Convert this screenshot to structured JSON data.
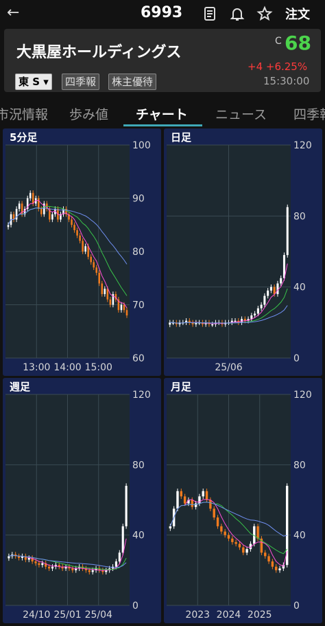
{
  "topbar": {
    "back_icon": "arrow-left-icon",
    "code": "6993",
    "order_label": "注文"
  },
  "header": {
    "name": "大黒屋ホールディングス",
    "close_mark": "C",
    "price": "68",
    "change": "+4 +6.25%",
    "time": "15:30:00",
    "market_badge": "東 S ▾",
    "badges": [
      "四季報",
      "株主優待"
    ]
  },
  "tabs": [
    {
      "label": "市況情報",
      "active": false
    },
    {
      "label": "歩み値",
      "active": false
    },
    {
      "label": "チャート",
      "active": true
    },
    {
      "label": "ニュース",
      "active": false
    },
    {
      "label": "四季報",
      "active": false
    }
  ],
  "colors": {
    "up": "#ffffff",
    "down": "#f07a1e",
    "price_green": "#4cd44c",
    "change_red": "#ff3b3b",
    "panel_bg": "#17234f",
    "plot_bg": "#1d2930",
    "accent": "#3fa9b8"
  },
  "chart_data": [
    {
      "type": "candlestick",
      "title": "5分足",
      "ylim": [
        60,
        100
      ],
      "yticks": [
        "100",
        "90",
        "80",
        "70",
        "60"
      ],
      "xticks": [
        "13:00",
        "14:00",
        "15:00"
      ],
      "series": [
        {
          "values": [
            85,
            87,
            86,
            88,
            89,
            87,
            88,
            90,
            91,
            89,
            90,
            88,
            87,
            89,
            88,
            86,
            87,
            88,
            86,
            87,
            88,
            87,
            86,
            85,
            84,
            83,
            82,
            80,
            81,
            79,
            78,
            77,
            76,
            74,
            72,
            73,
            71,
            70,
            72,
            71,
            69,
            70,
            69,
            68
          ]
        }
      ]
    },
    {
      "type": "candlestick",
      "title": "日足",
      "ylim": [
        0,
        120
      ],
      "yticks": [
        "120",
        "80",
        "40",
        "0"
      ],
      "xticks": [
        "25/06"
      ],
      "series": [
        {
          "values": [
            20,
            20,
            19,
            20,
            20,
            21,
            20,
            19,
            20,
            20,
            19,
            20,
            19,
            19,
            20,
            20,
            19,
            20,
            20,
            21,
            21,
            20,
            22,
            21,
            22,
            24,
            25,
            28,
            30,
            35,
            38,
            40,
            36,
            42,
            45,
            58,
            85
          ]
        }
      ]
    },
    {
      "type": "candlestick",
      "title": "週足",
      "ylim": [
        0,
        120
      ],
      "yticks": [
        "120",
        "80",
        "40",
        "0"
      ],
      "xticks": [
        "24/10",
        "25/01",
        "25/04"
      ],
      "series": [
        {
          "values": [
            28,
            29,
            28,
            27,
            28,
            26,
            27,
            25,
            24,
            23,
            24,
            22,
            21,
            22,
            23,
            22,
            21,
            22,
            21,
            20,
            21,
            22,
            21,
            20,
            19,
            20,
            21,
            20,
            19,
            20,
            21,
            22,
            25,
            30,
            45,
            68
          ]
        }
      ]
    },
    {
      "type": "candlestick",
      "title": "月足",
      "ylim": [
        0,
        120
      ],
      "yticks": [
        "120",
        "80",
        "40",
        "0"
      ],
      "xticks": [
        "2023",
        "2024",
        "2025"
      ],
      "series": [
        {
          "values": [
            45,
            55,
            65,
            62,
            58,
            60,
            56,
            58,
            62,
            65,
            60,
            55,
            50,
            45,
            42,
            40,
            38,
            36,
            35,
            33,
            30,
            32,
            35,
            45,
            38,
            30,
            28,
            25,
            22,
            20,
            21,
            23,
            68
          ]
        }
      ]
    }
  ]
}
